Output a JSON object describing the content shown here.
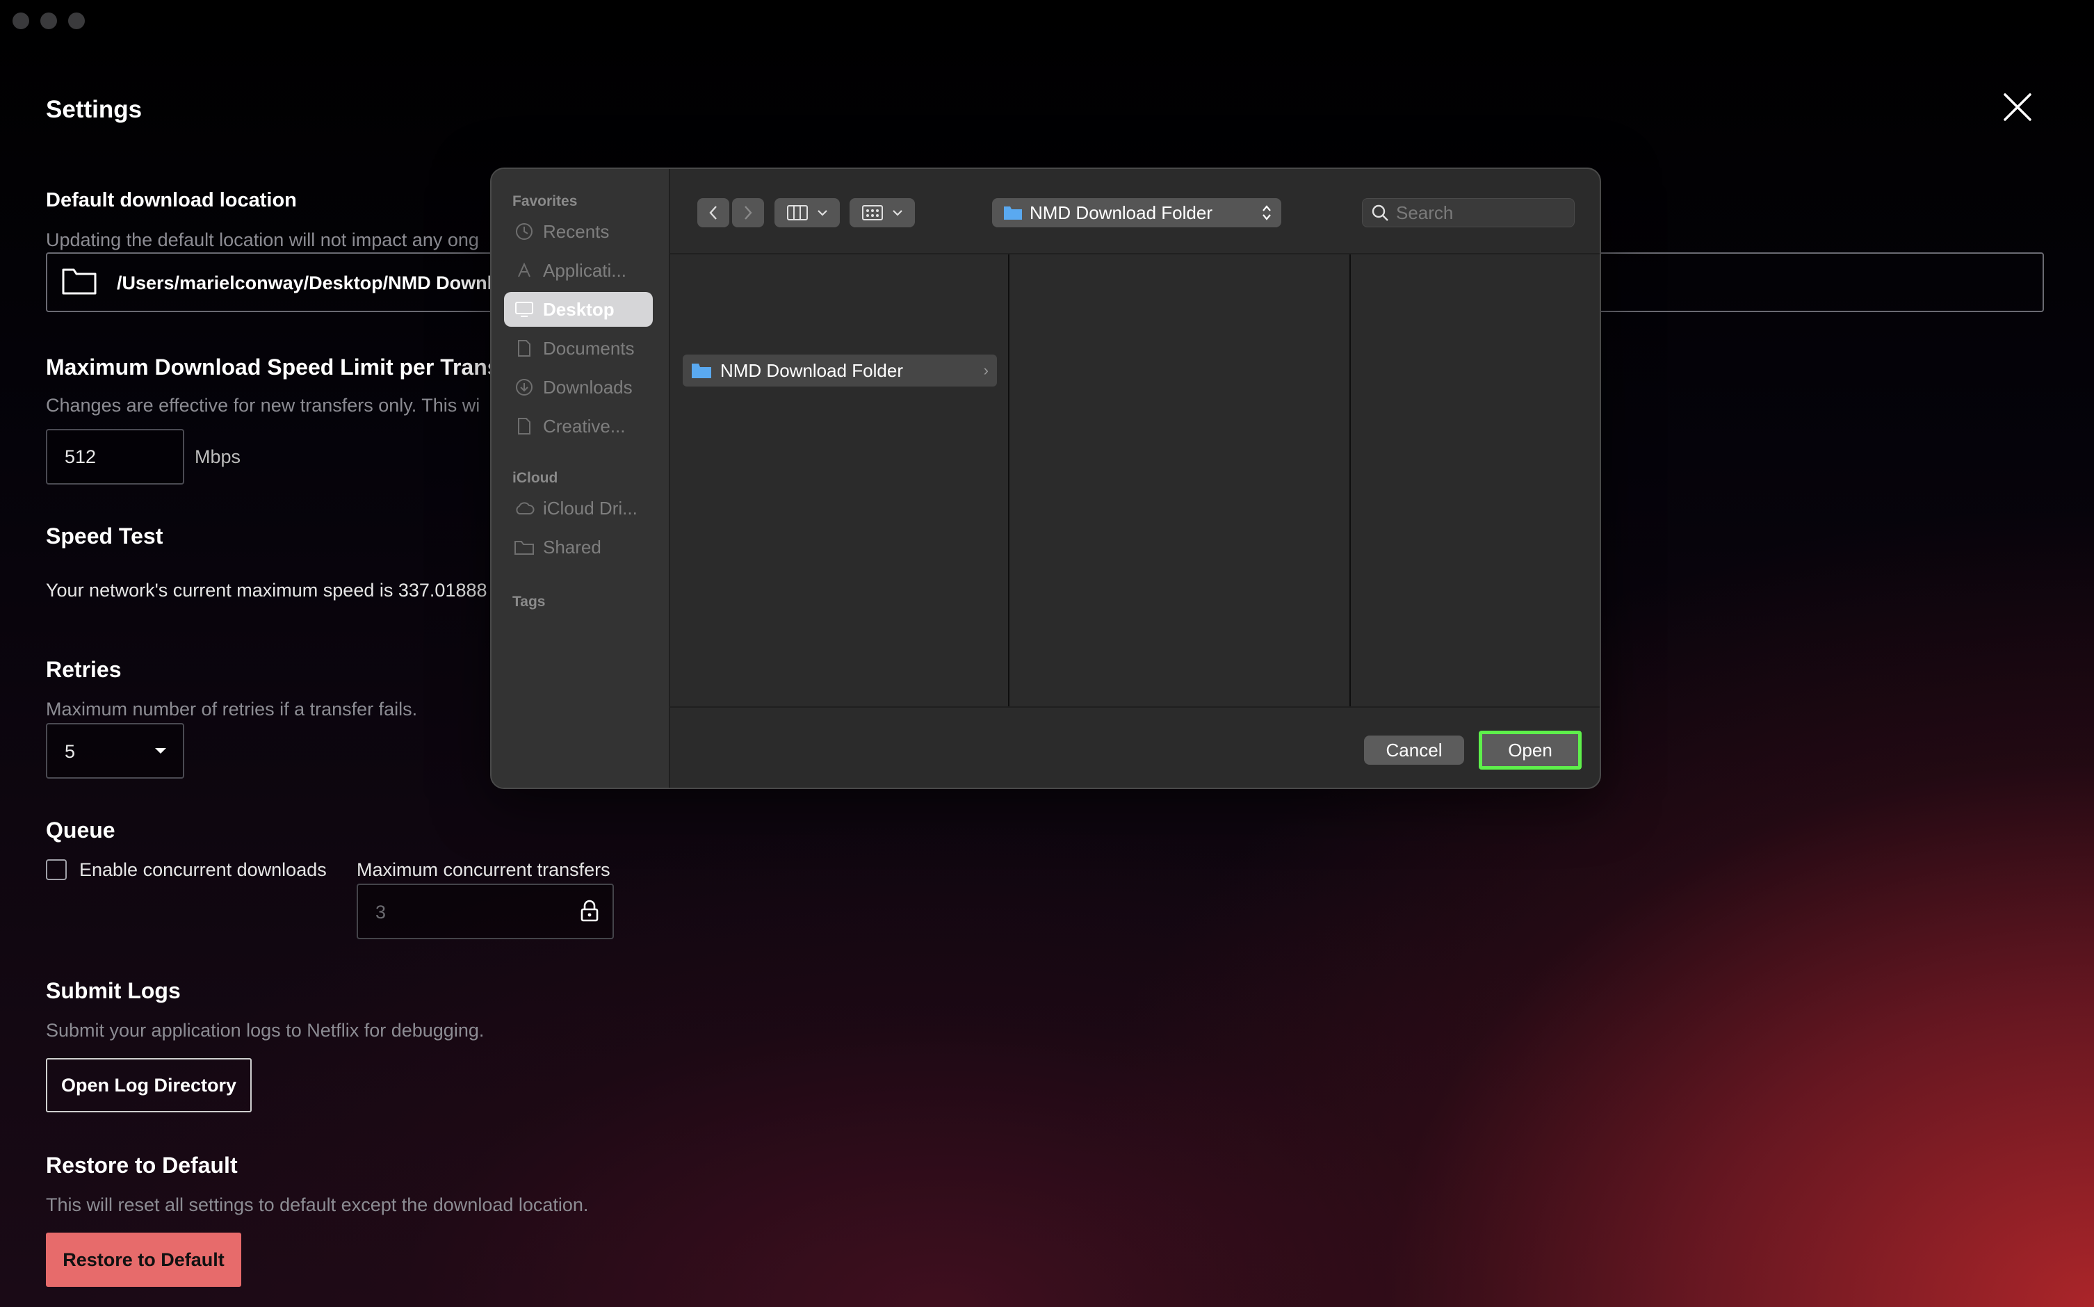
{
  "page": {
    "title": "Settings",
    "download_location": {
      "title": "Default download location",
      "subtitle": "Updating the default location will not impact any ong",
      "path": "/Users/marielconway/Desktop/NMD Downl"
    },
    "speed_limit": {
      "title": "Maximum Download Speed Limit per Trans",
      "subtitle": "Changes are effective for new transfers only. This wi",
      "value": "512",
      "unit": "Mbps"
    },
    "speed_test": {
      "title": "Speed Test",
      "text": "Your network's current maximum speed is 337.01888"
    },
    "retries": {
      "title": "Retries",
      "subtitle": "Maximum number of retries if a transfer fails.",
      "value": "5"
    },
    "queue": {
      "title": "Queue",
      "checkbox_label": "Enable concurrent downloads",
      "max_label": "Maximum concurrent transfers",
      "max_value": "3",
      "checked": false
    },
    "logs": {
      "title": "Submit Logs",
      "subtitle": "Submit your application logs to Netflix for debugging.",
      "button": "Open Log Directory"
    },
    "restore": {
      "title": "Restore to Default",
      "subtitle": "This will reset all settings to default except the download location.",
      "button": "Restore to Default"
    }
  },
  "dialog": {
    "sidebar": {
      "favorites_label": "Favorites",
      "favorites": [
        {
          "label": "Recents",
          "icon": "clock-icon"
        },
        {
          "label": "Applicati...",
          "icon": "applications-icon"
        },
        {
          "label": "Desktop",
          "icon": "desktop-icon",
          "selected": true
        },
        {
          "label": "Documents",
          "icon": "document-icon"
        },
        {
          "label": "Downloads",
          "icon": "download-icon"
        },
        {
          "label": "Creative...",
          "icon": "document-icon"
        }
      ],
      "icloud_label": "iCloud",
      "icloud": [
        {
          "label": "iCloud Dri...",
          "icon": "cloud-icon"
        },
        {
          "label": "Shared",
          "icon": "shared-folder-icon"
        }
      ],
      "tags_label": "Tags"
    },
    "toolbar": {
      "current_folder": "NMD Download Folder",
      "search_placeholder": "Search"
    },
    "browser": {
      "items": [
        {
          "label": "NMD Download Folder"
        }
      ]
    },
    "buttons": {
      "cancel": "Cancel",
      "open": "Open"
    },
    "highlight_color": "#5ef04b"
  },
  "colors": {
    "restore_button": "#e76b6b",
    "dialog_bg": "#2b2b2b",
    "sidebar_selected": "#d6d6d8"
  }
}
